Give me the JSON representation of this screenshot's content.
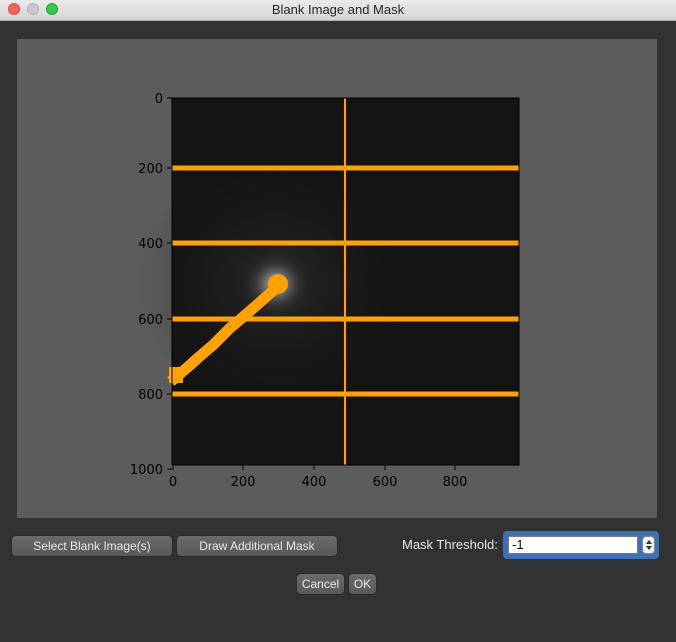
{
  "window": {
    "title": "Blank Image and Mask"
  },
  "plot": {
    "x_ticks": [
      "0",
      "200",
      "400",
      "600",
      "800"
    ],
    "y_ticks": [
      "0",
      "200",
      "400",
      "600",
      "800",
      "1000"
    ],
    "mask_color": "#ffa200"
  },
  "buttons": {
    "select_blank": "Select Blank Image(s)",
    "draw_mask": "Draw Additional Mask",
    "cancel": "Cancel",
    "ok": "OK"
  },
  "mask_threshold": {
    "label": "Mask Threshold:",
    "value": "-1"
  }
}
